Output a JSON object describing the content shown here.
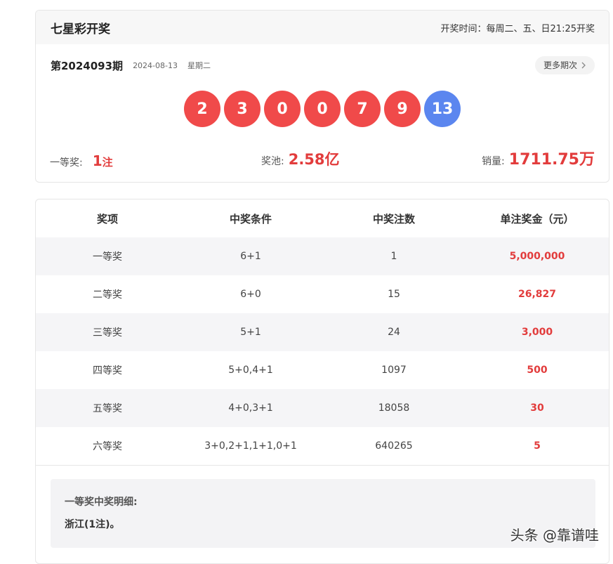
{
  "header": {
    "title": "七星彩开奖",
    "draw_time": "开奖时间：每周二、五、日21:25开奖"
  },
  "issue": {
    "number": "第2024093期",
    "date": "2024-08-13",
    "weekday": "星期二",
    "more_label": "更多期次"
  },
  "balls": {
    "red": [
      "2",
      "3",
      "0",
      "0",
      "7",
      "9"
    ],
    "blue": "13"
  },
  "stats": {
    "first_label": "一等奖:",
    "first_value": "1",
    "first_unit": "注",
    "pool_label": "奖池:",
    "pool_value": "2.58亿",
    "sales_label": "销量:",
    "sales_value": "1711.75万"
  },
  "table": {
    "headers": [
      "奖项",
      "中奖条件",
      "中奖注数",
      "单注奖金（元）"
    ],
    "rows": [
      {
        "level": "一等奖",
        "condition": "6+1",
        "count": "1",
        "prize": "5,000,000"
      },
      {
        "level": "二等奖",
        "condition": "6+0",
        "count": "15",
        "prize": "26,827"
      },
      {
        "level": "三等奖",
        "condition": "5+1",
        "count": "24",
        "prize": "3,000"
      },
      {
        "level": "四等奖",
        "condition": "5+0,4+1",
        "count": "1097",
        "prize": "500"
      },
      {
        "level": "五等奖",
        "condition": "4+0,3+1",
        "count": "18058",
        "prize": "30"
      },
      {
        "level": "六等奖",
        "condition": "3+0,2+1,1+1,0+1",
        "count": "640265",
        "prize": "5"
      }
    ]
  },
  "detail": {
    "title": "一等奖中奖明细:",
    "text": "浙江(1注)。"
  },
  "watermark": "头条 @靠谱哇",
  "colors": {
    "red_ball": "#f04a4a",
    "blue_ball": "#5b86ef",
    "highlight": "#e23c3c"
  }
}
